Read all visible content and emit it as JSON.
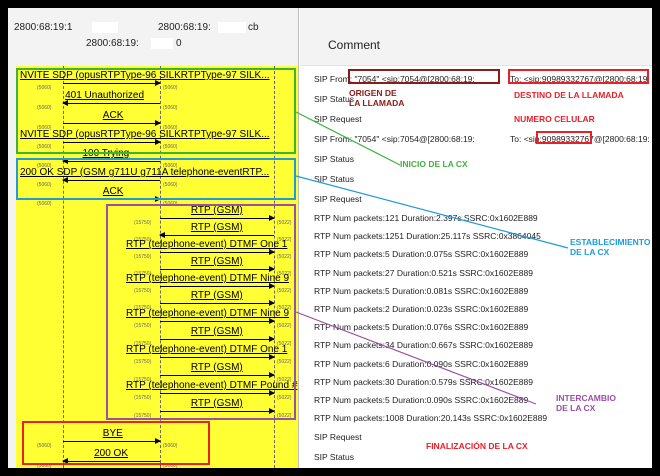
{
  "hosts": {
    "h1": "2800:68:19:1",
    "h2": "2800:68:19:",
    "h2b": "0",
    "h3": "2800:68:19:",
    "h3b": "cb"
  },
  "ports": {
    "p5060": "(5060)",
    "p15750": "(15750)",
    "p5022": "(5022)"
  },
  "flow": [
    {
      "label": "NVITE SDP (opusRTPType-96 SILKRTPType-97 SILK...",
      "dir": "right"
    },
    {
      "label": "401 Unauthorized",
      "dir": "left"
    },
    {
      "label": "ACK",
      "dir": "right"
    },
    {
      "label": "NVITE SDP (opusRTPType-96 SILKRTPType-97 SILK...",
      "dir": "right"
    },
    {
      "label": "100 Trying",
      "dir": "left"
    },
    {
      "label": "200 OK SDP (GSM g711U g711A telephone-eventRTP...",
      "dir": "left"
    },
    {
      "label": "ACK",
      "dir": "right"
    },
    {
      "label": "RTP (GSM)",
      "dir": "right"
    },
    {
      "label": "RTP (GSM)",
      "dir": "left"
    },
    {
      "label": "RTP (telephone-event) DTMF One 1",
      "dir": "right"
    },
    {
      "label": "RTP (GSM)",
      "dir": "right"
    },
    {
      "label": "RTP (telephone-event) DTMF Nine 9",
      "dir": "right"
    },
    {
      "label": "RTP (GSM)",
      "dir": "right"
    },
    {
      "label": "RTP (telephone-event) DTMF Nine 9",
      "dir": "right"
    },
    {
      "label": "RTP (GSM)",
      "dir": "right"
    },
    {
      "label": "RTP (telephone-event) DTMF One 1",
      "dir": "right"
    },
    {
      "label": "RTP (GSM)",
      "dir": "right"
    },
    {
      "label": "RTP (telephone-event) DTMF Pound #",
      "dir": "right"
    },
    {
      "label": "RTP (GSM)",
      "dir": "right"
    },
    {
      "label": "BYE",
      "dir": "right"
    },
    {
      "label": "200 OK",
      "dir": "left"
    }
  ],
  "comment": {
    "title": "Comment",
    "from1": "SIP From: \"7054\" <sip:7054@[2800:68:19:",
    "to1": "To: <sip:90989332767@[2800:68:19:    0]",
    "status1": "SIP Status",
    "request1": "SIP Request",
    "from2": "SIP From: \"7054\" <sip:7054@[2800:68:19:",
    "to2": "To: <sip:90989332767@[2800:68:19:    0]",
    "status2": "SIP Status",
    "status3": "SIP Status",
    "request2": "SIP Request",
    "rtp": [
      "RTP Num packets:121  Duration:2.397s SSRC:0x1602E889",
      "RTP Num packets:1251  Duration:25.117s SSRC:0x3864045",
      "RTP Num packets:5  Duration:0.075s SSRC:0x1602E889",
      "RTP Num packets:27  Duration:0.521s SSRC:0x1602E889",
      "RTP Num packets:5  Duration:0.081s SSRC:0x1602E889",
      "RTP Num packets:2  Duration:0.023s SSRC:0x1602E889",
      "RTP Num packets:5  Duration:0.076s SSRC:0x1602E889",
      "RTP Num packets:34  Duration:0.667s SSRC:0x1602E889",
      "RTP Num packets:6  Duration:0.090s SSRC:0x1602E889",
      "RTP Num packets:30  Duration:0.579s SSRC:0x1602E889",
      "RTP Num packets:5  Duration:0.090s SSRC:0x1602E889",
      "RTP Num packets:1008  Duration:20.143s SSRC:0x1602E889"
    ],
    "request3": "SIP Request",
    "status4": "SIP Status"
  },
  "annotations": {
    "origen": "ORIGEN DE\nLA LLAMADA",
    "destino": "DESTINO DE LA LLAMADA",
    "numero": "NUMERO CELULAR",
    "inicio": "INICIO DE LA CX",
    "establecimiento": "ESTABLECIMIENTO\nDE LA CX",
    "intercambio": "INTERCAMBIO\nDE LA CX",
    "finalizacion": "FINALIZACIÓN DE LA CX"
  },
  "colors": {
    "green": "#3cb43c",
    "blue": "#1e9bdc",
    "purple": "#9b4fa6",
    "red": "#e8202a",
    "darkred": "#8b1a1a",
    "yellow": "#ffff33"
  }
}
